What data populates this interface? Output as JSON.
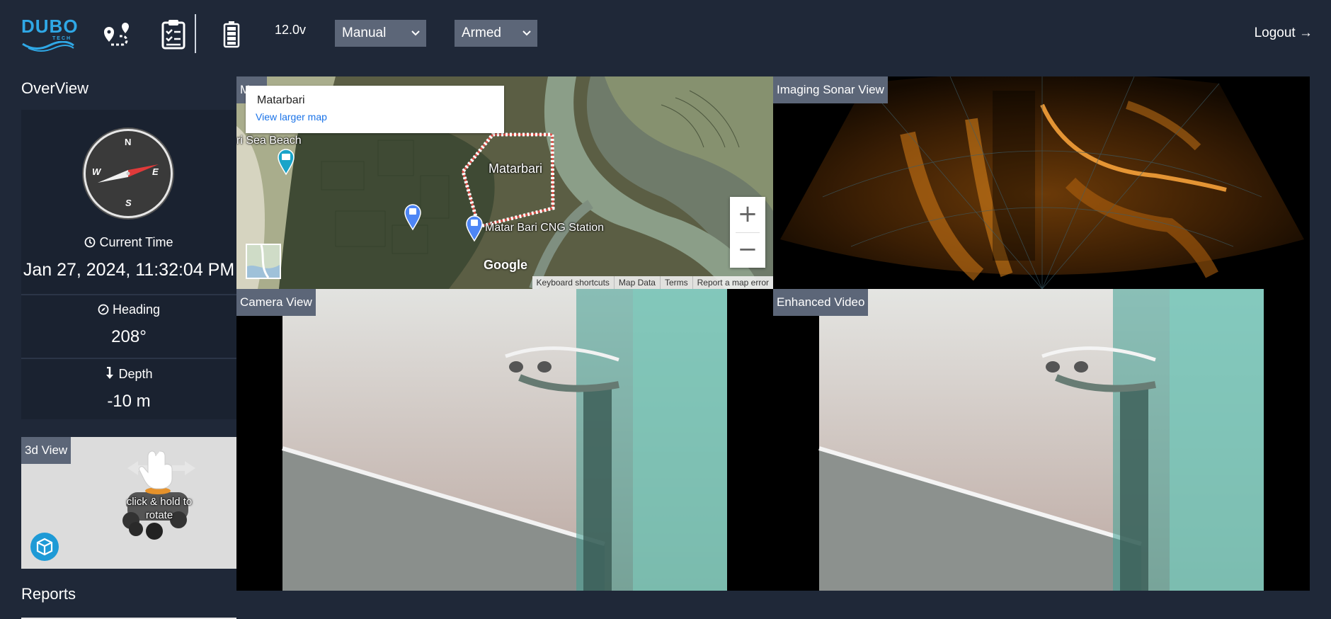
{
  "header": {
    "logo_text": "DUBO",
    "logo_sub": "TECH",
    "voltage": "12.0v",
    "mode_select": "Manual",
    "arm_select": "Armed",
    "logout": "Logout →"
  },
  "sidebar": {
    "title": "OverView",
    "compass": {
      "n": "N",
      "s": "S",
      "e": "E",
      "w": "W"
    },
    "time_label": "Current Time",
    "time_value": "Jan 27, 2024, 11:32:04 PM",
    "heading_label": "Heading",
    "heading_value": "208°",
    "depth_label": "Depth",
    "depth_value": "-10 m",
    "view3d_label": "3d View",
    "rotate_hint": "click & hold to rotate",
    "reports_title": "Reports"
  },
  "map": {
    "label": "Map",
    "card_place": "Matarbari",
    "card_link": "View larger map",
    "place_label": "Matarbari",
    "beach_label": "ri Sea Beach",
    "station_label": "Matar Bari CNG Station",
    "google": "Google",
    "attributions": [
      "Keyboard shortcuts",
      "Map Data",
      "Terms",
      "Report a map error"
    ]
  },
  "sonar": {
    "label": "Imaging Sonar View"
  },
  "camera": {
    "label": "Camera View"
  },
  "enhanced": {
    "label": "Enhanced Video"
  },
  "colors": {
    "background": "#1f2838",
    "tag": "#5c6678",
    "brand": "#2fa8e6"
  }
}
